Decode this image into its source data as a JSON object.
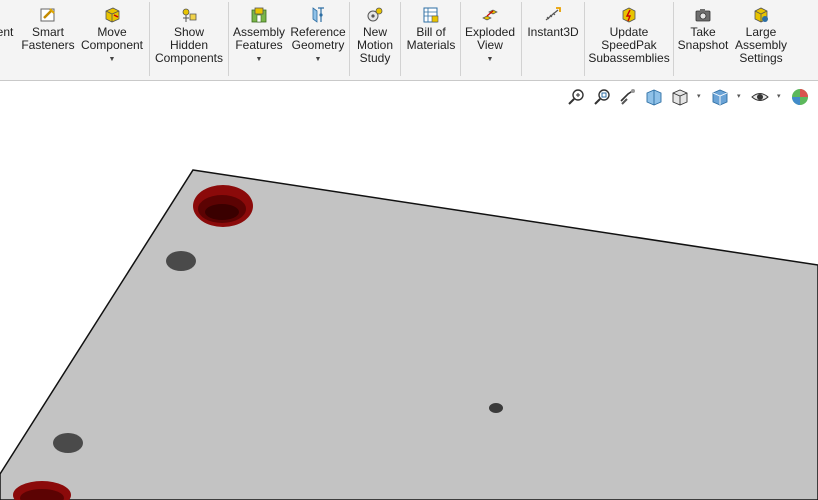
{
  "ribbon": {
    "partial_left": "ent",
    "smart_fasteners": "Smart\nFasteners",
    "move_component": "Move\nComponent",
    "show_hidden_components": "Show\nHidden\nComponents",
    "assembly_features": "Assembly\nFeatures",
    "reference_geometry": "Reference\nGeometry",
    "new_motion_study": "New\nMotion\nStudy",
    "bill_of_materials": "Bill of\nMaterials",
    "exploded_view": "Exploded\nView",
    "instant3d": "Instant3D",
    "update_speedpak": "Update\nSpeedPak\nSubassemblies",
    "take_snapshot": "Take\nSnapshot",
    "large_assembly_settings": "Large\nAssembly\nSettings",
    "dropdown_glyph": "▼"
  },
  "heads_up_toolbar": {
    "icons": [
      "zoom-to-fit-icon",
      "zoom-to-area-icon",
      "previous-view-icon",
      "section-view-icon",
      "view-orientation-icon",
      "display-style-icon",
      "hide-show-items-icon",
      "edit-appearance-icon"
    ],
    "dropdown_glyph": "▾"
  },
  "colors": {
    "plate_face": "#c3c3c3",
    "plate_edge": "#111111",
    "counterbore": "#8b0a0a",
    "counterbore_inner": "#5c0303",
    "hole": "#3a3a3a",
    "ribbon_bg": "#f4f4f4"
  }
}
